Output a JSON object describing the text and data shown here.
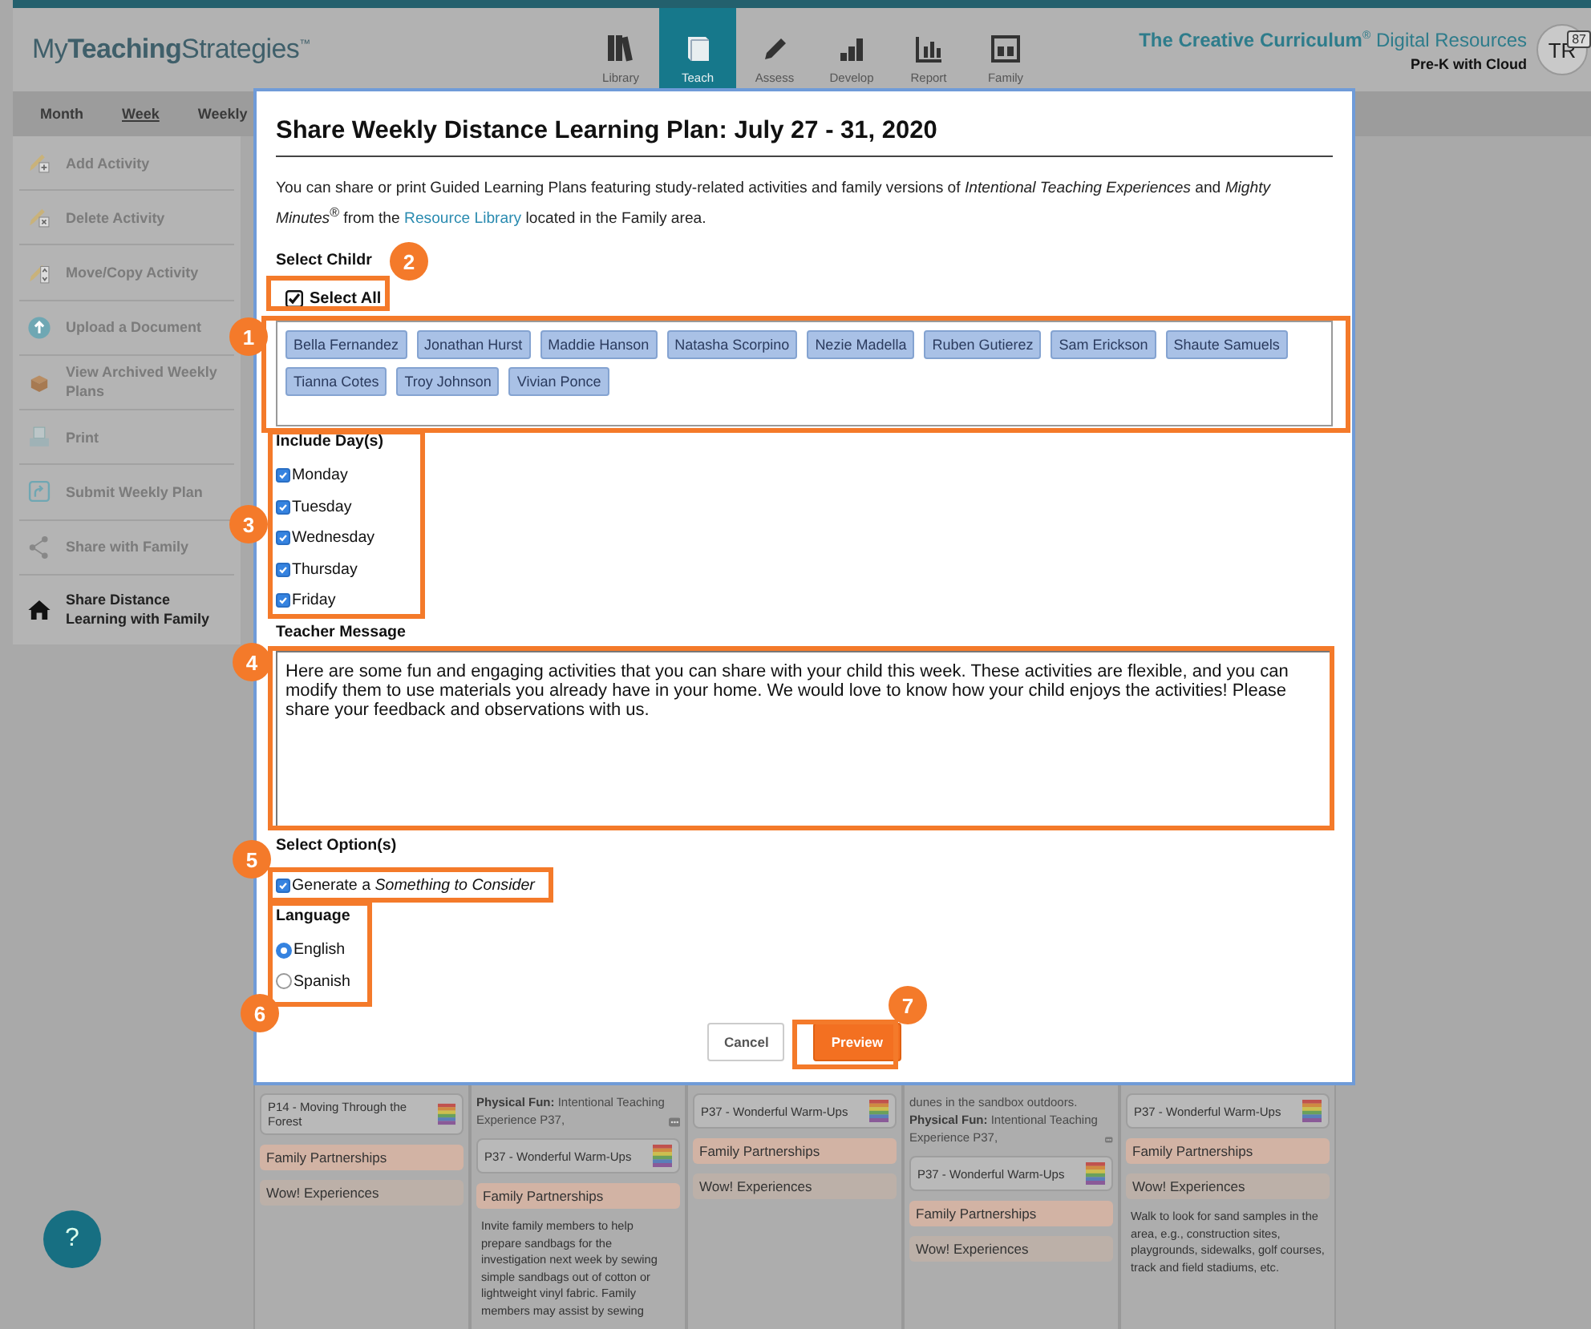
{
  "header": {
    "logo": "My**Teaching**Strategies$^{™}$",
    "nav": [
      {
        "label": "Library",
        "selected": false
      },
      {
        "label": "Teach",
        "selected": true
      },
      {
        "label": "Assess",
        "selected": false
      },
      {
        "label": "Develop",
        "selected": false
      },
      {
        "label": "Report",
        "selected": false
      },
      {
        "label": "Family",
        "selected": false
      }
    ],
    "product": "**The Creative Curriculum**$^{®}$ Digital Resources",
    "edition": "Pre-K with Cloud",
    "user": {
      "initials": "TR",
      "badge": "87"
    }
  },
  "subnav": [
    {
      "label": "Month",
      "selected": false
    },
    {
      "label": "Week",
      "selected": true
    },
    {
      "label": "Weekly",
      "selected": false
    }
  ],
  "sidebar": [
    {
      "label": "Add Activity",
      "selected": false
    },
    {
      "label": "Delete Activity",
      "selected": false
    },
    {
      "label": "Move/Copy Activity",
      "selected": false
    },
    {
      "label": "Upload a Document",
      "selected": false
    },
    {
      "label": "View Archived Weekly Plans",
      "selected": false
    },
    {
      "label": "Print",
      "selected": false
    },
    {
      "label": "Submit Weekly Plan",
      "selected": false
    },
    {
      "label": "Share with Family",
      "selected": false
    },
    {
      "label": "Share Distance Learning with Family",
      "selected": true
    }
  ],
  "board": {
    "columns": [
      {
        "items": [
          {
            "kind": "activity",
            "text": "P14 - Moving Through the Forest"
          },
          {
            "kind": "heading",
            "text": "Family Partnerships",
            "color": "#d2b3a4"
          },
          {
            "kind": "heading",
            "text": "Wow! Experiences",
            "color": "#bcb0a8"
          }
        ]
      },
      {
        "items": [
          {
            "kind": "note",
            "text": "**Physical Fun:** Intentional Teaching Experience P37,"
          },
          {
            "kind": "activity",
            "text": "P37 - Wonderful Warm-Ups"
          },
          {
            "kind": "heading",
            "text": "Family Partnerships",
            "color": "#d2b3a4"
          },
          {
            "kind": "description",
            "text": "Invite family members to help prepare sandbags for the investigation next week by sewing simple sandbags out of cotton or lightweight vinyl fabric. Family members may assist by sewing"
          }
        ]
      },
      {
        "items": [
          {
            "kind": "activity",
            "text": "P37 - Wonderful Warm-Ups"
          },
          {
            "kind": "heading",
            "text": "Family Partnerships",
            "color": "#d2b3a4"
          },
          {
            "kind": "heading",
            "text": "Wow! Experiences",
            "color": "#bcb0a8"
          }
        ]
      },
      {
        "items": [
          {
            "kind": "note",
            "text": "dunes in the sandbox outdoors. **Physical Fun:** Intentional Teaching Experience P37,"
          },
          {
            "kind": "activity",
            "text": "P37 - Wonderful Warm-Ups"
          },
          {
            "kind": "heading",
            "text": "Family Partnerships",
            "color": "#d2b3a4"
          },
          {
            "kind": "heading",
            "text": "Wow! Experiences",
            "color": "#bcb0a8"
          }
        ]
      },
      {
        "items": [
          {
            "kind": "activity",
            "text": "P37 - Wonderful Warm-Ups"
          },
          {
            "kind": "heading",
            "text": "Family Partnerships",
            "color": "#d2b3a4"
          },
          {
            "kind": "heading",
            "text": "Wow! Experiences",
            "color": "#bcb0a8"
          },
          {
            "kind": "description",
            "text": "Walk to look for sand samples in the area, e.g., construction sites, playgrounds, sidewalks, golf courses, track and field stadiums, etc."
          }
        ]
      }
    ]
  },
  "help": {
    "label": "?"
  },
  "dialog": {
    "title": "Share Weekly Distance Learning Plan: July 27 - 31, 2020",
    "intro_before": "You can share or print Guided Learning Plans featuring study-related activities and family versions of *Intentional Teaching Experiences* and *Mighty Minutes*$^{®}$ from the",
    "intro_link": "Resource Library",
    "intro_after": "located in the Family area.",
    "children": {
      "label": "Select Childr",
      "select_all": {
        "label": "Select All",
        "checked": true
      },
      "names": [
        "Bella Fernandez",
        "Jonathan Hurst",
        "Maddie Hanson",
        "Natasha Scorpino",
        "Nezie Madella",
        "Ruben Gutierez",
        "Sam Erickson",
        "Shaute Samuels",
        "Tianna Cotes",
        "Troy Johnson",
        "Vivian Ponce"
      ]
    },
    "days": {
      "label": "Include Day(s)",
      "items": [
        {
          "label": "Monday",
          "checked": true
        },
        {
          "label": "Tuesday",
          "checked": true
        },
        {
          "label": "Wednesday",
          "checked": true
        },
        {
          "label": "Thursday",
          "checked": true
        },
        {
          "label": "Friday",
          "checked": true
        }
      ]
    },
    "message": {
      "label": "Teacher Message",
      "value": "Here are some fun and engaging activities that you can share with your child this week. These activities are flexible, and you can modify them to use materials you already have in your home. We would love to know how your child enjoys the activities! Please share your feedback and observations with us."
    },
    "options": {
      "label": "Select Option(s)",
      "items": [
        {
          "label": "Generate a *Something to Consider*",
          "checked": true
        }
      ]
    },
    "language": {
      "label": "Language",
      "items": [
        {
          "label": "English",
          "selected": true
        },
        {
          "label": "Spanish",
          "selected": false
        }
      ]
    },
    "buttons": [
      {
        "label": "Cancel",
        "kind": "secondary"
      },
      {
        "label": "Preview",
        "kind": "primary"
      }
    ]
  },
  "callouts": [
    {
      "number": "1"
    },
    {
      "number": "2"
    },
    {
      "number": "3"
    },
    {
      "number": "4"
    },
    {
      "number": "5"
    },
    {
      "number": "6"
    },
    {
      "number": "7"
    }
  ]
}
